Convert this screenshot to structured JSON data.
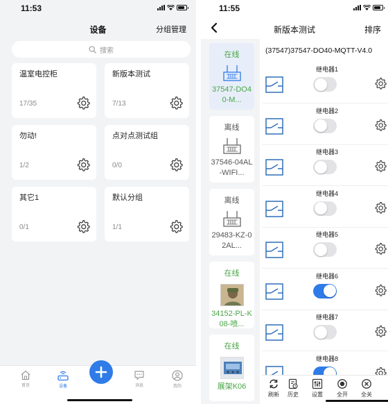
{
  "left": {
    "time": "11:53",
    "title": "设备",
    "manage_label": "分组管理",
    "search_placeholder": "搜索",
    "groups": [
      {
        "name": "温室电控柜",
        "count": "17/35"
      },
      {
        "name": "新版本测试",
        "count": "7/13"
      },
      {
        "name": "勿动!",
        "count": "1/2"
      },
      {
        "name": "点对点测试组",
        "count": "0/0"
      },
      {
        "name": "其它1",
        "count": "0/1"
      },
      {
        "name": "默认分组",
        "count": "1/1"
      }
    ],
    "tabs": [
      {
        "label": "首页",
        "icon": "home-icon"
      },
      {
        "label": "设备",
        "icon": "router-icon"
      },
      {
        "label": "消息",
        "icon": "message-icon"
      },
      {
        "label": "我的",
        "icon": "user-icon"
      }
    ],
    "active_tab": "设备",
    "plus_icon": "plus-icon"
  },
  "right": {
    "time": "11:55",
    "title": "新版本测试",
    "sort_label": "排序",
    "device_title": "(37547)37547-DO40-MQTT-V4.0",
    "devices": [
      {
        "status": "在线",
        "name": "37547-DO40-M...",
        "online": true
      },
      {
        "status": "离线",
        "name": "37546-04AL-WIFI...",
        "online": false
      },
      {
        "status": "离线",
        "name": "29483-KZ-02AL...",
        "online": false
      },
      {
        "status": "在线",
        "name": "34152-PL-K08-喷...",
        "online": true
      },
      {
        "status": "在线",
        "name": "展架K06",
        "online": true
      }
    ],
    "relays": [
      {
        "label": "继电器1",
        "on": false
      },
      {
        "label": "继电器2",
        "on": false
      },
      {
        "label": "继电器3",
        "on": false
      },
      {
        "label": "继电器4",
        "on": false
      },
      {
        "label": "继电器5",
        "on": false
      },
      {
        "label": "继电器6",
        "on": true
      },
      {
        "label": "继电器7",
        "on": false
      },
      {
        "label": "继电器8",
        "on": true
      }
    ],
    "tools": [
      {
        "label": "刷新",
        "icon": "refresh-icon"
      },
      {
        "label": "历史",
        "icon": "history-icon"
      },
      {
        "label": "设置",
        "icon": "settings-icon"
      },
      {
        "label": "全开",
        "icon": "all-on-icon"
      },
      {
        "label": "全关",
        "icon": "all-off-icon"
      }
    ]
  },
  "colors": {
    "accent": "#2f7be8",
    "online": "#49a546",
    "background": "#f2f3f5"
  }
}
